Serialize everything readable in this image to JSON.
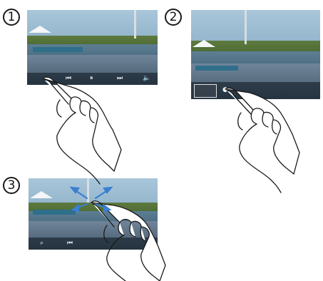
{
  "steps": [
    {
      "number": "1"
    },
    {
      "number": "2"
    },
    {
      "number": "3"
    }
  ],
  "icons": {
    "previous": "skip-previous-icon",
    "pause": "pause-icon",
    "next": "skip-next-icon",
    "volume": "volume-icon",
    "search": "search-icon",
    "zoom_gesture": "pinch-zoom-arrows-icon"
  },
  "colors": {
    "outline": "#1a1a1a",
    "gesture_arrows": "#3a7fd0"
  }
}
